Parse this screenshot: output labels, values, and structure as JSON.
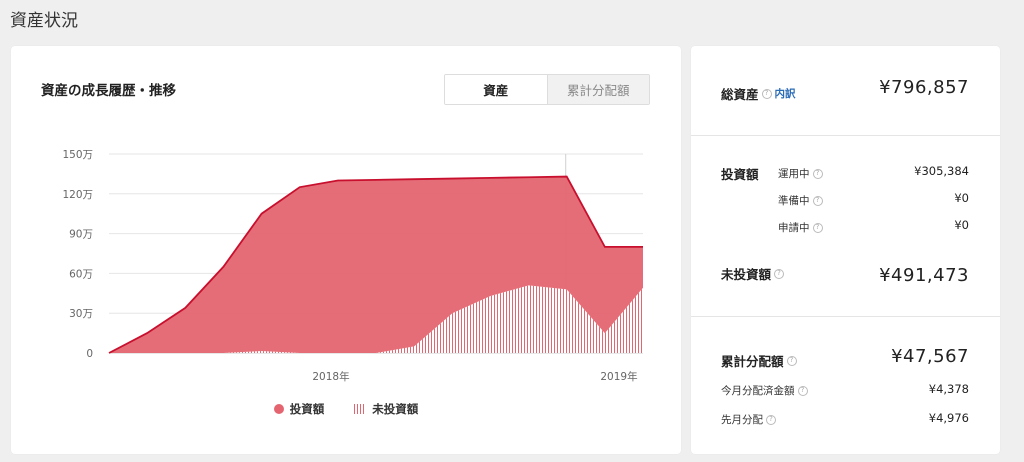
{
  "page": {
    "title": "資産状況"
  },
  "chart_panel": {
    "title": "資産の成長履歴・推移",
    "tabs": [
      {
        "label": "資産",
        "active": true
      },
      {
        "label": "累計分配額",
        "active": false
      }
    ],
    "legend": [
      {
        "label": "投資額",
        "style": "solid"
      },
      {
        "label": "未投資額",
        "style": "hatched"
      }
    ]
  },
  "chart_data": {
    "type": "area",
    "x_tick_labels": [
      "2018年",
      "2019年"
    ],
    "y_tick_labels": [
      "0",
      "30万",
      "60万",
      "90万",
      "120万",
      "150万"
    ],
    "ylim": [
      0,
      1500000
    ],
    "series": [
      {
        "name": "投資額",
        "color": "#e46570",
        "line_color": "#c8102e",
        "values": [
          0,
          150000,
          340000,
          650000,
          1050000,
          1250000,
          1300000,
          1305000,
          1310000,
          1315000,
          1320000,
          1325000,
          1330000,
          800000,
          800000
        ]
      },
      {
        "name": "未投資額",
        "color": "#e46570",
        "style": "hatched",
        "values": [
          0,
          0,
          0,
          0,
          15000,
          0,
          0,
          0,
          50000,
          300000,
          430000,
          510000,
          480000,
          150000,
          491473
        ]
      }
    ],
    "grid": true
  },
  "summary": {
    "total_assets": {
      "label": "総資産",
      "link": "内訳",
      "value": "¥796,857"
    },
    "investment": {
      "label": "投資額",
      "rows": [
        {
          "label": "運用中",
          "value": "¥305,384"
        },
        {
          "label": "準備中",
          "value": "¥0"
        },
        {
          "label": "申請中",
          "value": "¥0"
        }
      ]
    },
    "uninvested": {
      "label": "未投資額",
      "value": "¥491,473"
    },
    "cumulative": {
      "label": "累計分配額",
      "value": "¥47,567",
      "rows": [
        {
          "label": "今月分配済金額",
          "value": "¥4,378"
        },
        {
          "label": "先月分配",
          "value": "¥4,976"
        }
      ]
    },
    "help_glyph": "?"
  }
}
